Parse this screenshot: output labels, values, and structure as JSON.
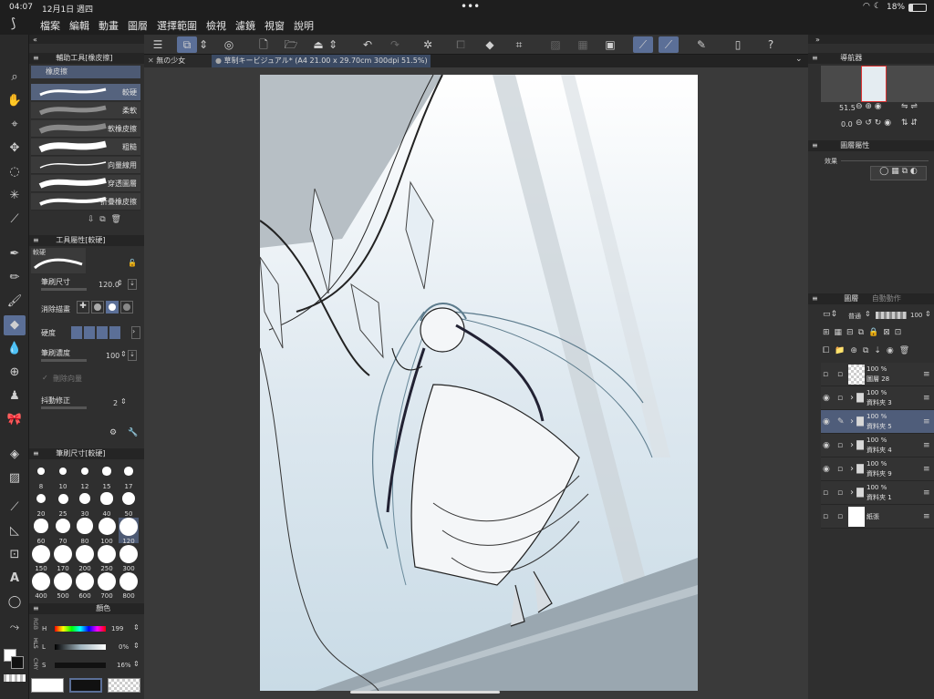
{
  "status": {
    "time": "04:07",
    "date": "12月1日 週四",
    "battery": "18%",
    "dots": "•••"
  },
  "menu": [
    "檔案",
    "編輯",
    "動畫",
    "圖層",
    "選擇範圍",
    "檢視",
    "濾鏡",
    "視窗",
    "說明"
  ],
  "tabs": {
    "tab1": "無の少女",
    "tab2": "草制キービジュアル* (A4 21.00 x 29.70cm 300dpi 51.5%)"
  },
  "subtool_panel": {
    "title": "輔助工具[橡皮擦]",
    "group": "橡皮擦",
    "brushes": [
      "較硬",
      "柔軟",
      "軟橡皮擦",
      "粗糙",
      "向量線用",
      "穿透圖層",
      "折疊橡皮擦"
    ]
  },
  "tool_property": {
    "title": "工具屬性[較硬]",
    "preset": "較硬",
    "brush_size_label": "筆刷尺寸",
    "brush_size_value": "120.0",
    "mode_label": "消除描畫",
    "hardness_label": "硬度",
    "density_label": "筆刷濃度",
    "density_value": "100",
    "delete_vector_label": "刪除向量",
    "stabilizer_label": "抖動修正",
    "stabilizer_value": "2"
  },
  "brush_size_panel": {
    "title": "筆刷尺寸[較硬]",
    "sizes": [
      "8",
      "10",
      "12",
      "15",
      "17",
      "20",
      "25",
      "30",
      "40",
      "50",
      "60",
      "70",
      "80",
      "100",
      "120",
      "150",
      "170",
      "200",
      "250",
      "300",
      "400",
      "500",
      "600",
      "700",
      "800"
    ]
  },
  "color_panel": {
    "title": "顏色",
    "h_label": "H",
    "h_value": "199",
    "l_label": "L",
    "l_value": "0%",
    "s_label": "S",
    "s_value": "16%",
    "modes": [
      "RGB",
      "HLS",
      "CMY"
    ]
  },
  "navigator": {
    "title": "導航器",
    "zoom": "51.5",
    "rotation": "0.0"
  },
  "layer_property": {
    "title": "圖層屬性",
    "effect_label": "效果"
  },
  "layers_panel": {
    "tab1": "圖層",
    "tab2": "自動動作",
    "blend_mode": "普通",
    "opacity": "100",
    "layers": [
      {
        "opacity": "100 %",
        "name": "圖層 28",
        "visible": false,
        "kind": "raster"
      },
      {
        "opacity": "100 %",
        "name": "資料夾 3",
        "visible": true,
        "kind": "folder"
      },
      {
        "opacity": "100 %",
        "name": "資料夾 5",
        "visible": true,
        "kind": "folder"
      },
      {
        "opacity": "100 %",
        "name": "資料夾 4",
        "visible": true,
        "kind": "folder"
      },
      {
        "opacity": "100 %",
        "name": "資料夾 9",
        "visible": true,
        "kind": "folder"
      },
      {
        "opacity": "100 %",
        "name": "資料夾 1",
        "visible": false,
        "kind": "folder"
      },
      {
        "opacity": "",
        "name": "紙張",
        "visible": false,
        "kind": "paper"
      }
    ]
  },
  "colors": {
    "accent": "#5b6f97",
    "canvas_bg": "#3a3a3a"
  }
}
